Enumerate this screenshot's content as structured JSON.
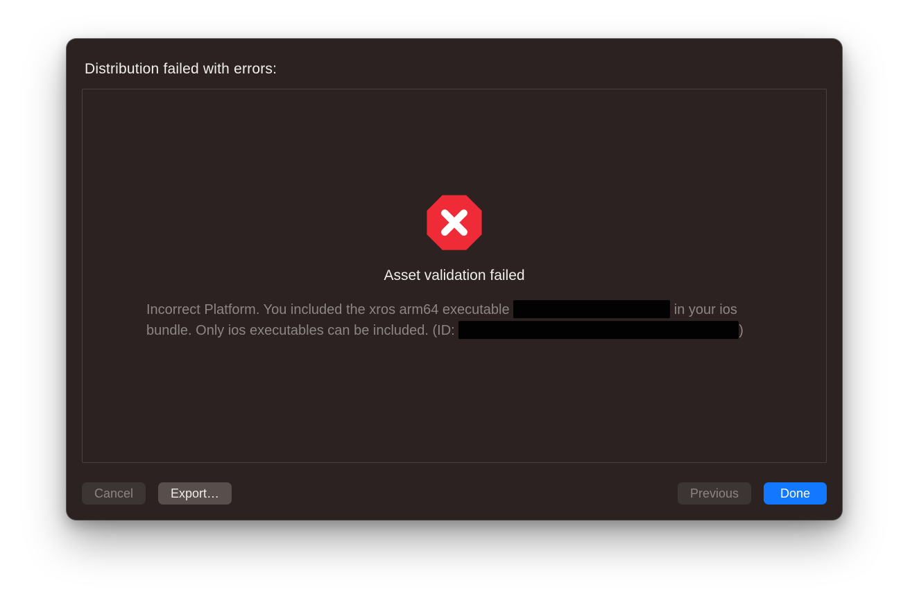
{
  "header": {
    "title": "Distribution failed with errors:"
  },
  "error": {
    "title": "Asset validation failed",
    "desc_part1": "Incorrect Platform. You included the xros arm64 executable ",
    "desc_part2": " in your ios bundle. Only ios executables can be included. (ID: ",
    "desc_part3": ")"
  },
  "buttons": {
    "cancel": "Cancel",
    "export": "Export…",
    "previous": "Previous",
    "done": "Done"
  },
  "colors": {
    "sheet_bg": "#2b2221",
    "accent": "#1278ff",
    "error_red": "#ee2b37"
  }
}
